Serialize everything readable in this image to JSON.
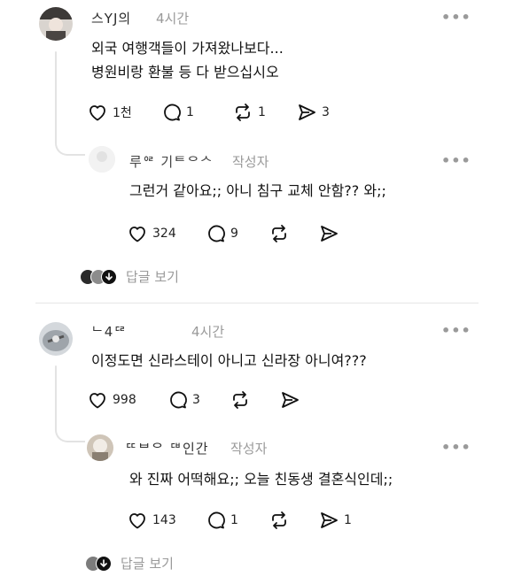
{
  "thread1": {
    "comment": {
      "username": "스YJ의",
      "time": "4시간",
      "lines": [
        "외국 여행객들이 가져왔나보다...",
        "병원비랑 환불 등 다 받으십시오"
      ],
      "likes": "1천",
      "replies": "1",
      "reposts": "1",
      "shares": "3"
    },
    "reply": {
      "username": "루ᄋᄅ 기ᄐᄋᄉ",
      "meta": "작성자",
      "text": "그런거 같아요;; 아니 침구 교체 안함?? 와;;",
      "likes": "324",
      "replies": "9"
    },
    "view_replies": "답글 보기"
  },
  "thread2": {
    "comment": {
      "username": "ᄂ4ᄃᄅ",
      "time": "4시간",
      "text": "이정도면 신라스테이 아니고 신라장 아니여???",
      "likes": "998",
      "replies": "3"
    },
    "reply": {
      "username": "ᄄᄇᄋ ᄃᄇ인간",
      "meta": "작성자",
      "text": "와 진짜 어떡해요;; 오늘 친동생 결혼식인데;;",
      "likes": "143",
      "replies": "1",
      "shares": "1"
    },
    "view_replies": "답글 보기"
  },
  "icons": [
    "heart-icon",
    "comment-icon",
    "repost-icon",
    "share-icon",
    "more-icon"
  ]
}
